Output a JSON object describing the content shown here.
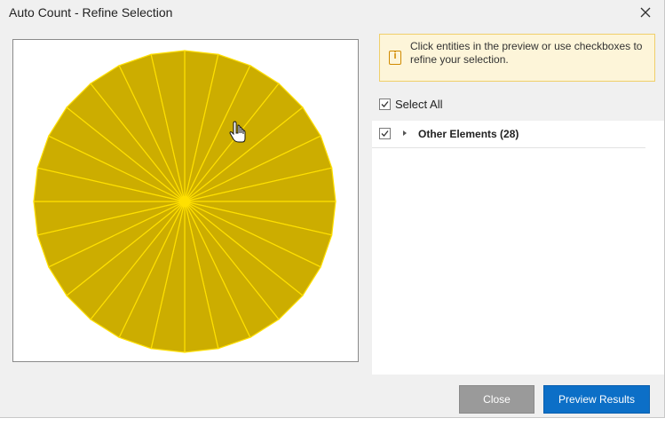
{
  "window": {
    "title": "Auto Count - Refine Selection"
  },
  "info": {
    "message": "Click entities in the preview or use checkboxes to refine your selection.",
    "icon": "info-icon",
    "background": "#fdf5d9",
    "border": "#f0cf6a"
  },
  "select_all": {
    "label": "Select All",
    "checked": true
  },
  "tree": {
    "items": [
      {
        "label": "Other Elements (28)",
        "checked": true,
        "expanded": false
      }
    ]
  },
  "preview": {
    "shape": "circle divided into wedge segments",
    "segments": 28,
    "fill": "#ccad00",
    "stroke": "#ffe000"
  },
  "buttons": {
    "close_label": "Close",
    "preview_label": "Preview Results"
  },
  "colors": {
    "accent": "#0c6fc7",
    "disabled_button": "#9a9a9a"
  }
}
